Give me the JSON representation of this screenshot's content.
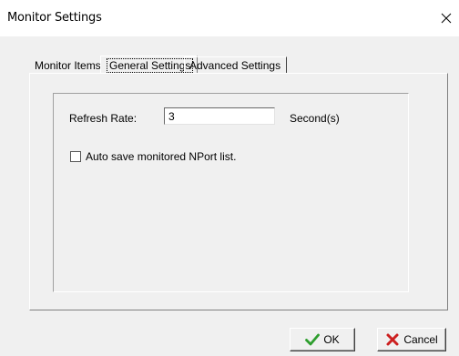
{
  "window": {
    "title": "Monitor Settings",
    "close_icon": "close-icon"
  },
  "tabs": [
    {
      "label": "Monitor Items",
      "active": false
    },
    {
      "label": "General Settings",
      "active": true
    },
    {
      "label": "Advanced Settings",
      "active": false
    }
  ],
  "general": {
    "refresh_label": "Refresh Rate:",
    "refresh_value": "3",
    "refresh_unit": "Second(s)",
    "autosave_label": "Auto save monitored NPort list.",
    "autosave_checked": false
  },
  "buttons": {
    "ok_label": "OK",
    "ok_icon": "check-icon",
    "ok_icon_color": "#2e9e2e",
    "cancel_label": "Cancel",
    "cancel_icon": "x-icon",
    "cancel_icon_color": "#cc1f1f"
  }
}
